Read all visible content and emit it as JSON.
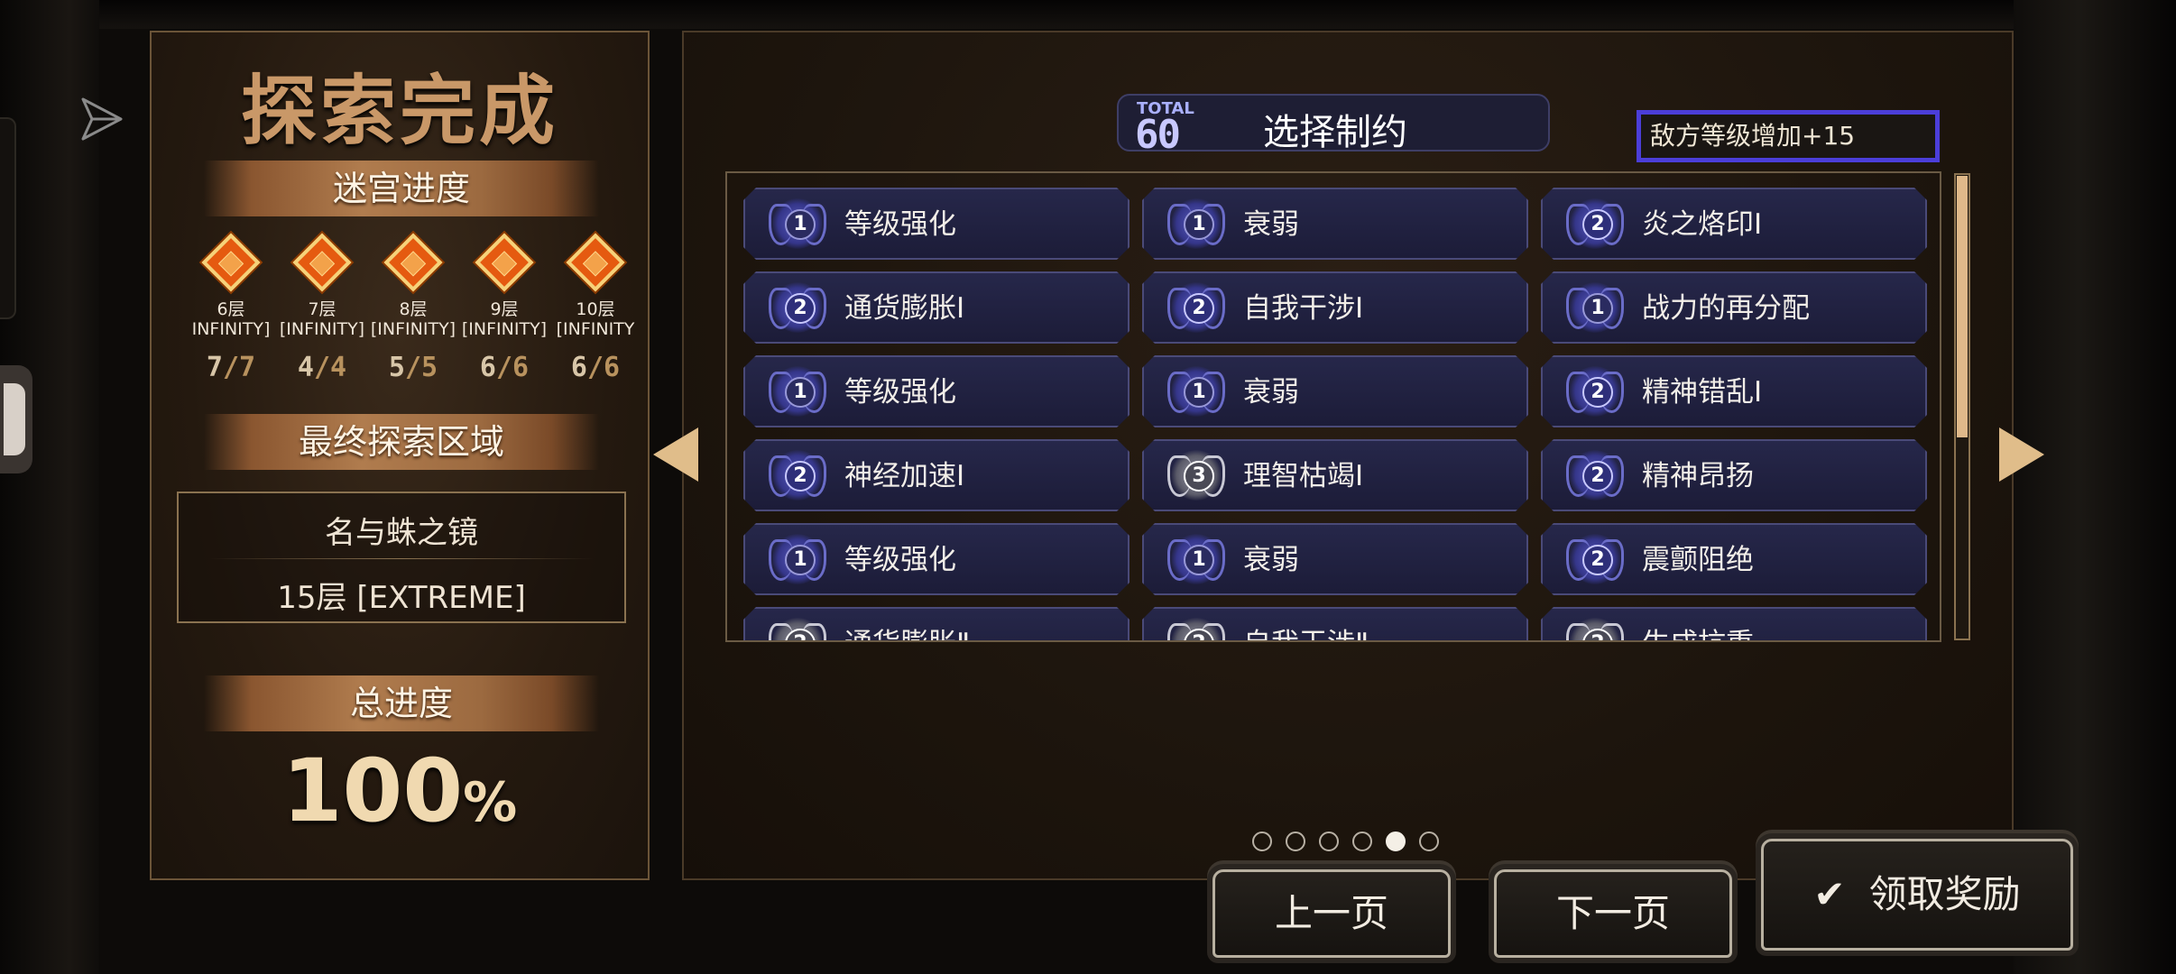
{
  "left": {
    "title": "探索完成",
    "maze_progress_label": "迷宫进度",
    "floors": [
      {
        "label": "6层",
        "mode": "INFINITY]",
        "done": "7",
        "total": "7"
      },
      {
        "label": "7层",
        "mode": "[INFINITY]",
        "done": "4",
        "total": "4"
      },
      {
        "label": "8层",
        "mode": "[INFINITY]",
        "done": "5",
        "total": "5"
      },
      {
        "label": "9层",
        "mode": "[INFINITY]",
        "done": "6",
        "total": "6"
      },
      {
        "label": "10层",
        "mode": "[INFINITY",
        "done": "6",
        "total": "6"
      }
    ],
    "final_area_label": "最终探索区域",
    "final_area_name": "名与蛛之镜",
    "final_area_floor": "15层 [EXTREME]",
    "total_progress_label": "总进度",
    "total_progress_value": "100",
    "total_progress_unit": "%"
  },
  "right": {
    "total_label": "TOTAL",
    "total_value": "60",
    "select_title": "选择制约",
    "enemy_level_text": "敌方等级增加+15",
    "cards": [
      {
        "level": "1",
        "label": "等级强化",
        "style": "dim"
      },
      {
        "level": "1",
        "label": "衰弱",
        "style": "dim"
      },
      {
        "level": "2",
        "label": "炎之烙印Ⅰ",
        "style": "blue"
      },
      {
        "level": "2",
        "label": "通货膨胀Ⅰ",
        "style": "blue"
      },
      {
        "level": "2",
        "label": "自我干涉Ⅰ",
        "style": "blue"
      },
      {
        "level": "1",
        "label": "战力的再分配",
        "style": "dim"
      },
      {
        "level": "1",
        "label": "等级强化",
        "style": "dim"
      },
      {
        "level": "1",
        "label": "衰弱",
        "style": "dim"
      },
      {
        "level": "2",
        "label": "精神错乱Ⅰ",
        "style": "blue"
      },
      {
        "level": "2",
        "label": "神经加速Ⅰ",
        "style": "blue"
      },
      {
        "level": "3",
        "label": "理智枯竭Ⅰ",
        "style": "silver"
      },
      {
        "level": "2",
        "label": "精神昂扬",
        "style": "blue"
      },
      {
        "level": "1",
        "label": "等级强化",
        "style": "dim"
      },
      {
        "level": "1",
        "label": "衰弱",
        "style": "dim"
      },
      {
        "level": "2",
        "label": "震颤阻绝",
        "style": "blue"
      },
      {
        "level": "2",
        "label": "通货膨胀Ⅱ",
        "style": "silver"
      },
      {
        "level": "2",
        "label": "自我干涉Ⅱ",
        "style": "silver"
      },
      {
        "level": "2",
        "label": "生成抗重",
        "style": "silver"
      }
    ],
    "page_dots": 6,
    "active_page": 5
  },
  "buttons": {
    "prev": "上一页",
    "next": "下一页",
    "claim": "领取奖励",
    "claim_icon": "check-icon"
  },
  "colors": {
    "accent_blue": "#4b3ed9",
    "card_bg": "#22223f",
    "title_gold": "#c99868"
  }
}
